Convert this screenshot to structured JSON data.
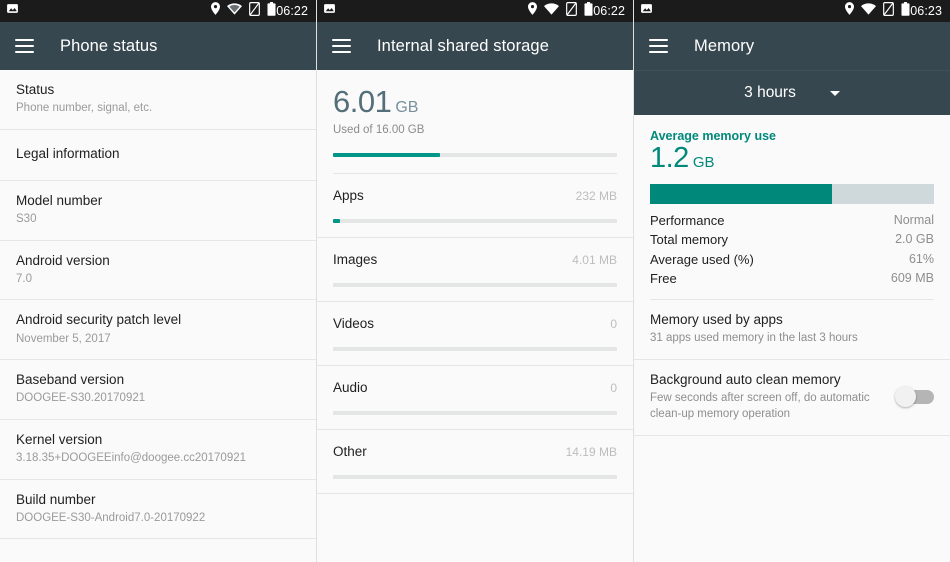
{
  "screens": [
    {
      "statusbar": {
        "time": "06:22",
        "icons_left": [
          "photo-icon"
        ],
        "icons_right": [
          "location-icon",
          "wifi-icon",
          "sim-card-off-icon",
          "battery-icon"
        ]
      },
      "toolbar": {
        "menu_icon": "hamburger-menu-icon",
        "title": "Phone status"
      },
      "rows": [
        {
          "title": "Status",
          "sub": "Phone number, signal, etc."
        },
        {
          "title": "Legal information",
          "sub": ""
        },
        {
          "title": "Model number",
          "sub": "S30"
        },
        {
          "title": "Android version",
          "sub": "7.0"
        },
        {
          "title": "Android security patch level",
          "sub": "November 5, 2017"
        },
        {
          "title": "Baseband version",
          "sub": "DOOGEE-S30.20170921"
        },
        {
          "title": "Kernel version",
          "sub": "3.18.35+DOOGEEinfo@doogee.cc20170921"
        },
        {
          "title": "Build number",
          "sub": "DOOGEE-S30-Android7.0-20170922"
        }
      ]
    },
    {
      "statusbar": {
        "time": "06:22",
        "icons_left": [
          "photo-icon"
        ],
        "icons_right": [
          "location-icon",
          "wifi-icon",
          "sim-card-off-icon",
          "battery-icon"
        ]
      },
      "toolbar": {
        "menu_icon": "hamburger-menu-icon",
        "title": "Internal shared storage"
      },
      "summary": {
        "value": "6.01",
        "unit": "GB",
        "caption": "Used of 16.00 GB",
        "fill_percent": 37.5
      },
      "categories": [
        {
          "name": "Apps",
          "size": "232 MB",
          "fill_percent": 2.6
        },
        {
          "name": "Images",
          "size": "4.01 MB",
          "fill_percent": 0
        },
        {
          "name": "Videos",
          "size": "0",
          "fill_percent": 0
        },
        {
          "name": "Audio",
          "size": "0",
          "fill_percent": 0
        },
        {
          "name": "Other",
          "size": "14.19 MB",
          "fill_percent": 0
        }
      ]
    },
    {
      "statusbar": {
        "time": "06:23",
        "icons_left": [
          "photo-icon"
        ],
        "icons_right": [
          "location-icon",
          "wifi-icon",
          "sim-card-off-icon",
          "battery-icon"
        ]
      },
      "toolbar": {
        "menu_icon": "hamburger-menu-icon",
        "title": "Memory"
      },
      "spinner": {
        "selected": "3 hours",
        "icon": "chevron-down-icon"
      },
      "summary": {
        "label": "Average memory use",
        "value": "1.2",
        "unit": "GB",
        "fill_percent": 64
      },
      "stats": [
        {
          "label": "Performance",
          "value": "Normal"
        },
        {
          "label": "Total memory",
          "value": "2.0 GB"
        },
        {
          "label": "Average used (%)",
          "value": "61%"
        },
        {
          "label": "Free",
          "value": "609 MB"
        }
      ],
      "rows": [
        {
          "title": "Memory used by apps",
          "sub": "31 apps used memory in the last 3 hours",
          "has_switch": false
        },
        {
          "title": "Background auto clean memory",
          "sub": "Few seconds after screen off, do automatic clean-up memory operation",
          "has_switch": true,
          "switch_on": false
        }
      ]
    }
  ],
  "colors": {
    "toolbar": "#37474F",
    "statusbar": "#1B1B1B",
    "accent_teal": "#009688",
    "memory_teal": "#00897B",
    "storage_blue_grey": "#546E7A"
  }
}
